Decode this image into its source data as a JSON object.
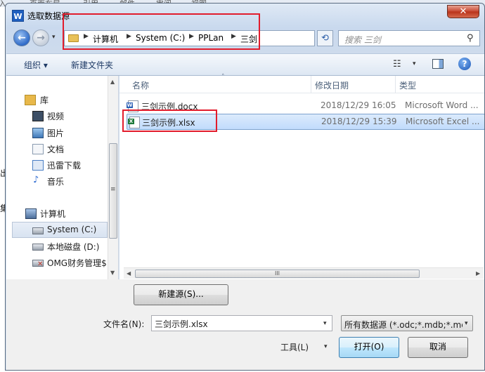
{
  "background": {
    "tabs": [
      "入",
      "页面布局",
      "引用",
      "邮件",
      "审阅",
      "视图"
    ],
    "left_chars": [
      "出",
      "集"
    ]
  },
  "dialog": {
    "app_icon": "W",
    "title": "选取数据源",
    "close_glyph": "✕"
  },
  "navigation": {
    "back_glyph": "←",
    "forward_glyph": "→",
    "dropdown_glyph": "▾",
    "breadcrumb": [
      "计算机",
      "System (C:)",
      "PPLan",
      "三剑"
    ],
    "refresh_glyph": "⟲",
    "search_placeholder": "搜索 三剑"
  },
  "toolbar": {
    "organize": "组织 ▾",
    "new_folder": "新建文件夹",
    "view_glyph": "☷",
    "help_glyph": "?"
  },
  "nav_pane": {
    "items": [
      {
        "label": "库",
        "icon": "library-icon",
        "color": "#e8b84a"
      },
      {
        "label": "视频",
        "icon": "video-icon",
        "color": "#3d4f66"
      },
      {
        "label": "图片",
        "icon": "pictures-icon",
        "color": "#3f78b8"
      },
      {
        "label": "文档",
        "icon": "documents-icon",
        "color": "#8a9bb0"
      },
      {
        "label": "迅雷下载",
        "icon": "download-icon",
        "color": "#4a7fc4"
      },
      {
        "label": "音乐",
        "icon": "music-icon",
        "color": "#2d6bd1"
      },
      {
        "label": "计算机",
        "icon": "computer-icon",
        "color": "#4c6e9a"
      },
      {
        "label": "System (C:)",
        "icon": "drive-icon",
        "color": "#7d8794"
      },
      {
        "label": "本地磁盘 (D:)",
        "icon": "drive-icon",
        "color": "#7d8794"
      },
      {
        "label": "OMG财务管理$",
        "icon": "network-drive-icon",
        "color": "#c0392b"
      }
    ],
    "selected_index": 7,
    "scroll_thumb_glyph": "≡"
  },
  "file_list": {
    "columns": [
      "名称",
      "修改日期",
      "类型"
    ],
    "sort_glyph": "˄",
    "rows": [
      {
        "name": "三剑示例.docx",
        "date": "2018/12/29 16:05",
        "type": "Microsoft Word ...",
        "badge": "W",
        "badge_color": "#2b5fb4"
      },
      {
        "name": "三剑示例.xlsx",
        "date": "2018/12/29 15:39",
        "type": "Microsoft Excel ...",
        "badge": "X",
        "badge_color": "#1f7a3a"
      }
    ],
    "selected_index": 1,
    "hscroll_thumb_glyph": "III"
  },
  "bottom": {
    "new_source_button": "新建源(S)...",
    "filename_label": "文件名(N):",
    "filename_value": "三剑示例.xlsx",
    "filetype_value": "所有数据源 (*.odc;*.mdb;*.mde",
    "tools_label": "工具(L)",
    "open_button": "打开(O)",
    "cancel_button": "取消"
  },
  "annotation_color": "#e21c2c"
}
